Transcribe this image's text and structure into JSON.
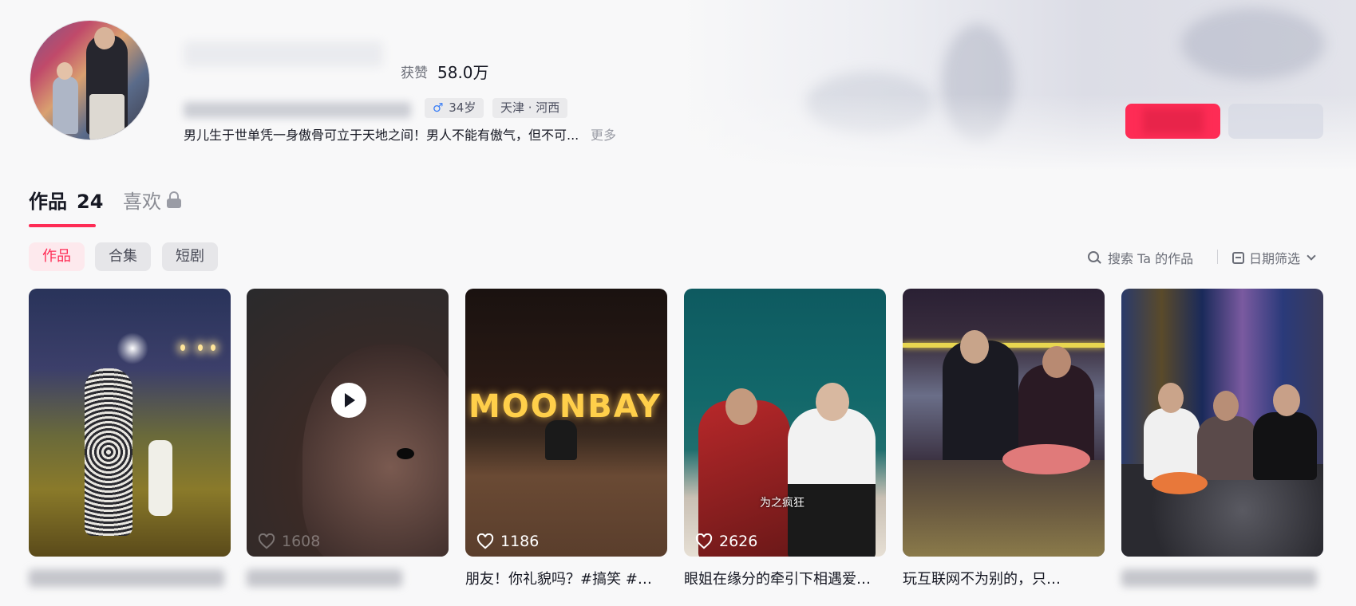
{
  "profile": {
    "likes_label": "获赞",
    "likes_value": "58.0万",
    "gender_symbol": "♂",
    "age": "34岁",
    "location": "天津 · 河西",
    "bio": "男儿生于世单凭一身傲骨可立于天地之间！男人不能有傲气，但不可...",
    "bio_more": "更多"
  },
  "tabs": {
    "works_label": "作品",
    "works_count": "24",
    "likes_label": "喜欢"
  },
  "filters": {
    "works": "作品",
    "collection": "合集",
    "drama": "短剧"
  },
  "search": {
    "placeholder": "搜索 Ta 的作品"
  },
  "date_filter": {
    "label": "日期筛选"
  },
  "videos": [
    {
      "likes": "",
      "title": ""
    },
    {
      "likes": "1608",
      "title": ""
    },
    {
      "likes": "1186",
      "title": "朋友！你礼貌吗？#搞笑 #…"
    },
    {
      "likes": "2626",
      "title": "眼姐在缘分的牵引下相遇爱…",
      "overlay_text": "为之疯狂"
    },
    {
      "likes": "",
      "title": "玩互联网不为别的，只…"
    },
    {
      "likes": "",
      "title": ""
    }
  ],
  "thumbnail_text": {
    "sign": "MOONBAY"
  },
  "colors": {
    "accent": "#fe2c55",
    "text": "#161823",
    "muted": "#6b6e78"
  }
}
